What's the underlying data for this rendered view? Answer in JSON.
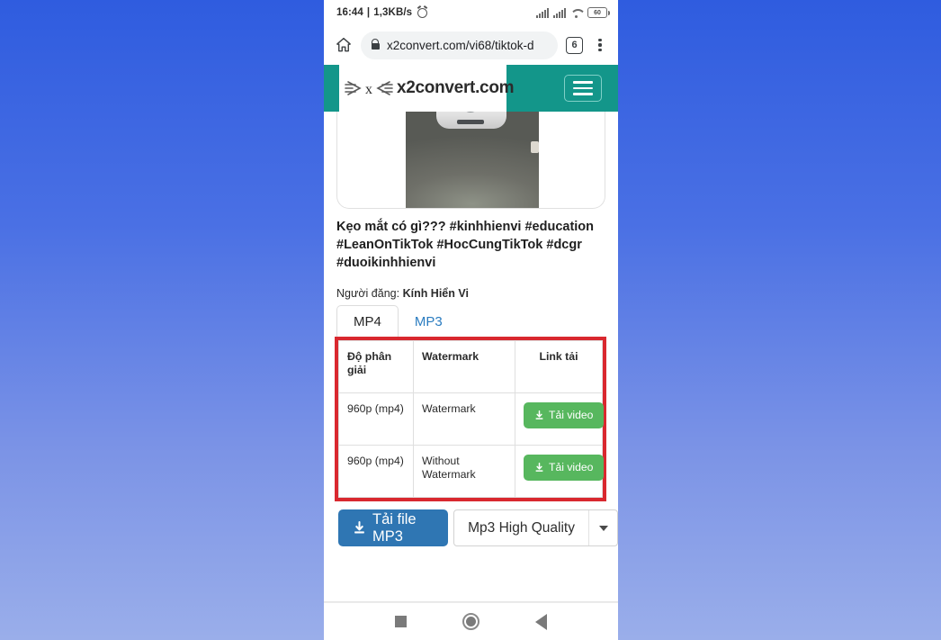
{
  "status_bar": {
    "time": "16:44",
    "separator": "|",
    "network_speed": "1,3KB/s",
    "alarm_icon": "alarm-clock-icon",
    "signal_icon": "signal-bars-icon",
    "wifi_icon": "wifi-icon",
    "battery_level": "60"
  },
  "browser": {
    "home_icon": "home-icon",
    "lock_icon": "lock-icon",
    "url": "x2convert.com/vi68/tiktok-d",
    "tab_count": "6",
    "menu_icon": "kebab-menu-icon"
  },
  "site_header": {
    "logo_text": "x2convert.com",
    "logo_mark": "x2convert-logo-icon",
    "menu_icon": "hamburger-menu-icon",
    "bg_color": "#13968a"
  },
  "video": {
    "thumbnail_alt": "video-thumbnail",
    "title": "Kẹo mắt có gì??? #kinhhienvi #education #LeanOnTikTok #HocCungTikTok #dcgr #duoikinhhienvi",
    "uploader_label": "Người đăng:",
    "uploader_name": "Kính Hiển Vi"
  },
  "tabs": [
    {
      "label": "MP4",
      "active": true
    },
    {
      "label": "MP3",
      "active": false
    }
  ],
  "table": {
    "highlight_color": "#d9282f",
    "headers": [
      "Độ phân giải",
      "Watermark",
      "Link tải"
    ],
    "rows": [
      {
        "resolution": "960p (mp4)",
        "watermark": "Watermark",
        "button": "Tải video"
      },
      {
        "resolution": "960p (mp4)",
        "watermark": "Without Watermark",
        "button": "Tải video"
      }
    ],
    "download_icon": "download-icon",
    "button_color": "#57b75e"
  },
  "mp3_section": {
    "download_button": "Tải file MP3",
    "download_icon": "download-icon",
    "quality_selected": "Mp3 High Quality",
    "caret_icon": "chevron-down-icon",
    "button_color": "#2f76b3"
  },
  "nav_bar": {
    "recents_icon": "square-recents-icon",
    "home_icon": "circle-home-icon",
    "back_icon": "triangle-back-icon"
  }
}
